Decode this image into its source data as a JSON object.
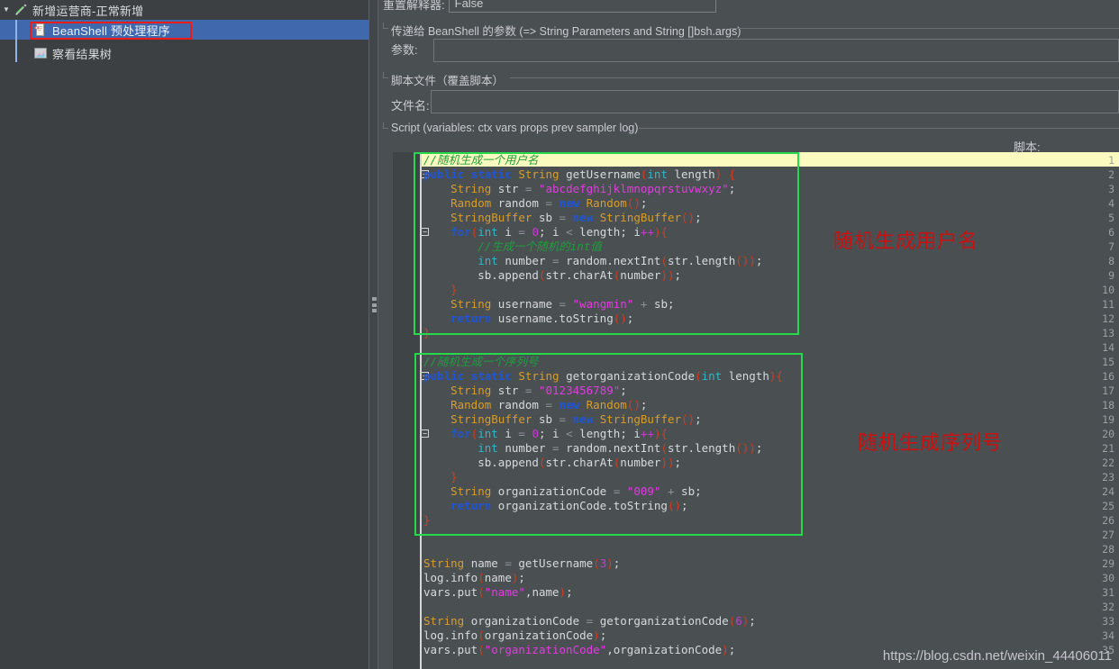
{
  "tree": {
    "nodes": [
      {
        "label": "新增运营商-正常新增",
        "icon": "pencil-icon",
        "expanded": true,
        "selected": false,
        "depth": 0
      },
      {
        "label": "BeanShell 预处理程序",
        "icon": "beanshell-preprocessor-icon",
        "selected": true,
        "depth": 1
      },
      {
        "label": "察看结果树",
        "icon": "view-results-tree-icon",
        "selected": false,
        "depth": 1
      }
    ],
    "twisty_collapsed": "▼"
  },
  "form": {
    "reset_interpreter_label": "重置解释器:",
    "reset_interpreter_value": "False",
    "parameters_group_title": "传递给 BeanShell 的参数 (=> String Parameters and String []bsh.args)",
    "parameters_label": "参数:",
    "parameters_value": "",
    "script_file_group_title": "脚本文件（覆盖脚本）",
    "filename_label": "文件名:",
    "filename_value": "",
    "script_group_title": "Script (variables: ctx vars props prev sampler log)",
    "script_label": "脚本:"
  },
  "annotations": {
    "note_username": "随机生成用户名",
    "note_serial": "随机生成序列号",
    "watermark": "https://blog.csdn.net/weixin_44406011"
  },
  "colors": {
    "selection_blue": "#4069ad",
    "annotation_red": "#cc1111",
    "annotation_green": "#25d94a",
    "highlight_yellow": "#fbfbbf",
    "panel_bg": "#4a4f52",
    "tree_bg": "#3c4043"
  },
  "code": {
    "first_line_number": 1,
    "last_line_number": 35,
    "fold_markers": [
      2,
      6,
      16,
      20
    ],
    "highlighted_line": 1,
    "lines": [
      {
        "n": 1,
        "text": "//随机生成一个用户名"
      },
      {
        "n": 2,
        "text": "public static String getUsername(int length) {"
      },
      {
        "n": 3,
        "text": "    String str = \"abcdefghijklmnopqrstuvwxyz\";"
      },
      {
        "n": 4,
        "text": "    Random random = new Random();"
      },
      {
        "n": 5,
        "text": "    StringBuffer sb = new StringBuffer();"
      },
      {
        "n": 6,
        "text": "    for(int i = 0; i < length; i++){"
      },
      {
        "n": 7,
        "text": "        //生成一个随机的int值"
      },
      {
        "n": 8,
        "text": "        int number = random.nextInt(str.length());"
      },
      {
        "n": 9,
        "text": "        sb.append(str.charAt(number));"
      },
      {
        "n": 10,
        "text": "    }"
      },
      {
        "n": 11,
        "text": "    String username = \"wangmin\" + sb;"
      },
      {
        "n": 12,
        "text": "    return username.toString();"
      },
      {
        "n": 13,
        "text": "}"
      },
      {
        "n": 14,
        "text": ""
      },
      {
        "n": 15,
        "text": "//随机生成一个序列号"
      },
      {
        "n": 16,
        "text": "public static String getorganizationCode(int length){"
      },
      {
        "n": 17,
        "text": "    String str = \"0123456789\";"
      },
      {
        "n": 18,
        "text": "    Random random = new Random();"
      },
      {
        "n": 19,
        "text": "    StringBuffer sb = new StringBuffer();"
      },
      {
        "n": 20,
        "text": "    for(int i = 0; i < length; i++){"
      },
      {
        "n": 21,
        "text": "        int number = random.nextInt(str.length());"
      },
      {
        "n": 22,
        "text": "        sb.append(str.charAt(number));"
      },
      {
        "n": 23,
        "text": "    }"
      },
      {
        "n": 24,
        "text": "    String organizationCode = \"009\" + sb;"
      },
      {
        "n": 25,
        "text": "    return organizationCode.toString();"
      },
      {
        "n": 26,
        "text": "}"
      },
      {
        "n": 27,
        "text": ""
      },
      {
        "n": 28,
        "text": ""
      },
      {
        "n": 29,
        "text": "String name = getUsername(3);"
      },
      {
        "n": 30,
        "text": "log.info(name);"
      },
      {
        "n": 31,
        "text": "vars.put(\"name\",name);"
      },
      {
        "n": 32,
        "text": ""
      },
      {
        "n": 33,
        "text": "String organizationCode = getorganizationCode(6);"
      },
      {
        "n": 34,
        "text": "log.info(organizationCode);"
      },
      {
        "n": 35,
        "text": "vars.put(\"organizationCode\",organizationCode);"
      }
    ],
    "html_lines": [
      {
        "n": 1,
        "html": "<span class=\"t-cmt\">//随机生成一个用户名</span>"
      },
      {
        "n": 2,
        "html": "<span class=\"t-kw\">public</span> <span class=\"t-kw\">static</span> <span class=\"t-type\">String</span> <span class=\"t-id\">getUsername</span><span class=\"t-paren\">(</span><span class=\"t-prim\">int</span> <span class=\"t-id\">length</span><span class=\"t-paren\">)</span> <span class=\"t-paren\">{</span>"
      },
      {
        "n": 3,
        "html": "    <span class=\"t-type\">String</span> <span class=\"t-id\">str</span> <span class=\"t-op\">=</span> <span class=\"t-str\">\"abcdefghijklmnopqrstuvwxyz\"</span>;"
      },
      {
        "n": 4,
        "html": "    <span class=\"t-type\">Random</span> <span class=\"t-id\">random</span> <span class=\"t-op\">=</span> <span class=\"t-kw\">new</span> <span class=\"t-type\">Random</span><span class=\"t-paren\">()</span>;"
      },
      {
        "n": 5,
        "html": "    <span class=\"t-type\">StringBuffer</span> <span class=\"t-id\">sb</span> <span class=\"t-op\">=</span> <span class=\"t-kw\">new</span> <span class=\"t-type\">StringBuffer</span><span class=\"t-paren\">()</span>;"
      },
      {
        "n": 6,
        "html": "    <span class=\"t-kw\">for</span><span class=\"t-paren\">(</span><span class=\"t-prim\">int</span> <span class=\"t-id\">i</span> <span class=\"t-op\">=</span> <span class=\"t-num\">0</span>; <span class=\"t-id\">i</span> <span class=\"t-op\">&lt;</span> <span class=\"t-id\">length</span>; <span class=\"t-id\">i</span><span class=\"t-num\">++</span><span class=\"t-paren\">)</span><span class=\"t-paren\">{</span>"
      },
      {
        "n": 7,
        "html": "        <span class=\"t-cmt\">//生成一个随机的int值</span>"
      },
      {
        "n": 8,
        "html": "        <span class=\"t-prim\">int</span> <span class=\"t-id\">number</span> <span class=\"t-op\">=</span> <span class=\"t-id\">random.nextInt</span><span class=\"t-paren\">(</span><span class=\"t-id\">str.length</span><span class=\"t-paren\">())</span>;"
      },
      {
        "n": 9,
        "html": "        <span class=\"t-id\">sb.append</span><span class=\"t-paren\">(</span><span class=\"t-id\">str.charAt</span><span class=\"t-paren\">(</span><span class=\"t-id\">number</span><span class=\"t-paren\">))</span>;"
      },
      {
        "n": 10,
        "html": "    <span class=\"t-paren\">}</span>"
      },
      {
        "n": 11,
        "html": "    <span class=\"t-type\">String</span> <span class=\"t-id\">username</span> <span class=\"t-op\">=</span> <span class=\"t-str\">\"wangmin\"</span> <span class=\"t-op\">+</span> <span class=\"t-id\">sb</span>;"
      },
      {
        "n": 12,
        "html": "    <span class=\"t-kw\">return</span> <span class=\"t-id\">username.toString</span><span class=\"t-paren\">()</span>;"
      },
      {
        "n": 13,
        "html": "<span class=\"t-paren\">}</span>"
      },
      {
        "n": 14,
        "html": ""
      },
      {
        "n": 15,
        "html": "<span class=\"t-cmt\">//随机生成一个序列号</span>"
      },
      {
        "n": 16,
        "html": "<span class=\"t-kw\">public</span> <span class=\"t-kw\">static</span> <span class=\"t-type\">String</span> <span class=\"t-id\">getorganizationCode</span><span class=\"t-paren\">(</span><span class=\"t-prim\">int</span> <span class=\"t-id\">length</span><span class=\"t-paren\">){</span>"
      },
      {
        "n": 17,
        "html": "    <span class=\"t-type\">String</span> <span class=\"t-id\">str</span> <span class=\"t-op\">=</span> <span class=\"t-str\">\"0123456789\"</span>;"
      },
      {
        "n": 18,
        "html": "    <span class=\"t-type\">Random</span> <span class=\"t-id\">random</span> <span class=\"t-op\">=</span> <span class=\"t-kw\">new</span> <span class=\"t-type\">Random</span><span class=\"t-paren\">()</span>;"
      },
      {
        "n": 19,
        "html": "    <span class=\"t-type\">StringBuffer</span> <span class=\"t-id\">sb</span> <span class=\"t-op\">=</span> <span class=\"t-kw\">new</span> <span class=\"t-type\">StringBuffer</span><span class=\"t-paren\">()</span>;"
      },
      {
        "n": 20,
        "html": "    <span class=\"t-kw\">for</span><span class=\"t-paren\">(</span><span class=\"t-prim\">int</span> <span class=\"t-id\">i</span> <span class=\"t-op\">=</span> <span class=\"t-num\">0</span>; <span class=\"t-id\">i</span> <span class=\"t-op\">&lt;</span> <span class=\"t-id\">length</span>; <span class=\"t-id\">i</span><span class=\"t-num\">++</span><span class=\"t-paren\">)</span><span class=\"t-paren\">{</span>"
      },
      {
        "n": 21,
        "html": "        <span class=\"t-prim\">int</span> <span class=\"t-id\">number</span> <span class=\"t-op\">=</span> <span class=\"t-id\">random.nextInt</span><span class=\"t-paren\">(</span><span class=\"t-id\">str.length</span><span class=\"t-paren\">())</span>;"
      },
      {
        "n": 22,
        "html": "        <span class=\"t-id\">sb.append</span><span class=\"t-paren\">(</span><span class=\"t-id\">str.charAt</span><span class=\"t-paren\">(</span><span class=\"t-id\">number</span><span class=\"t-paren\">))</span>;"
      },
      {
        "n": 23,
        "html": "    <span class=\"t-paren\">}</span>"
      },
      {
        "n": 24,
        "html": "    <span class=\"t-type\">String</span> <span class=\"t-id\">organizationCode</span> <span class=\"t-op\">=</span> <span class=\"t-str\">\"009\"</span> <span class=\"t-op\">+</span> <span class=\"t-id\">sb</span>;"
      },
      {
        "n": 25,
        "html": "    <span class=\"t-kw\">return</span> <span class=\"t-id\">organizationCode.toString</span><span class=\"t-paren\">()</span>;"
      },
      {
        "n": 26,
        "html": "<span class=\"t-paren\">}</span>"
      },
      {
        "n": 27,
        "html": ""
      },
      {
        "n": 28,
        "html": ""
      },
      {
        "n": 29,
        "html": "<span class=\"t-type\">String</span> <span class=\"t-id\">name</span> <span class=\"t-op\">=</span> <span class=\"t-id\">getUsername</span><span class=\"t-paren\">(</span><span class=\"t-num\">3</span><span class=\"t-paren\">)</span>;"
      },
      {
        "n": 30,
        "html": "<span class=\"t-id\">log.info</span><span class=\"t-paren\">(</span><span class=\"t-id\">name</span><span class=\"t-paren\">)</span>;"
      },
      {
        "n": 31,
        "html": "<span class=\"t-id\">vars.put</span><span class=\"t-paren\">(</span><span class=\"t-str\">\"name\"</span>,<span class=\"t-id\">name</span><span class=\"t-paren\">)</span>;"
      },
      {
        "n": 32,
        "html": ""
      },
      {
        "n": 33,
        "html": "<span class=\"t-type\">String</span> <span class=\"t-id\">organizationCode</span> <span class=\"t-op\">=</span> <span class=\"t-id\">getorganizationCode</span><span class=\"t-paren\">(</span><span class=\"t-num\">6</span><span class=\"t-paren\">)</span>;"
      },
      {
        "n": 34,
        "html": "<span class=\"t-id\">log.info</span><span class=\"t-paren\">(</span><span class=\"t-id\">organizationCode</span><span class=\"t-paren\">)</span>;"
      },
      {
        "n": 35,
        "html": "<span class=\"t-id\">vars.put</span><span class=\"t-paren\">(</span><span class=\"t-str\">\"organizationCode\"</span>,<span class=\"t-id\">organizationCode</span><span class=\"t-paren\">)</span>;"
      }
    ]
  }
}
